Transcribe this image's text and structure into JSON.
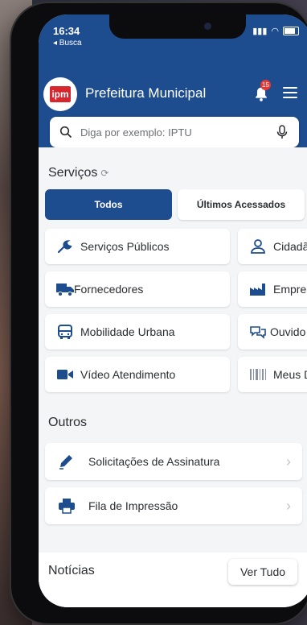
{
  "status": {
    "time": "16:34",
    "back": "◂ Busca"
  },
  "header": {
    "logo_text": "ipm",
    "title": "Prefeitura Municipal",
    "notification_count": "15"
  },
  "search": {
    "placeholder": "Diga por exemplo: IPTU"
  },
  "services": {
    "title": "Serviços",
    "tabs": [
      {
        "label": "Todos",
        "active": true
      },
      {
        "label": "Últimos Acessados",
        "active": false
      }
    ],
    "cards": [
      {
        "label": "Serviços Públicos",
        "icon": "wrench-icon"
      },
      {
        "label": "Cidadã",
        "icon": "person-icon"
      },
      {
        "label": "Fornecedores",
        "icon": "truck-icon"
      },
      {
        "label": "Empre",
        "icon": "factory-icon"
      },
      {
        "label": "Mobilidade Urbana",
        "icon": "bus-icon"
      },
      {
        "label": "Ouvido",
        "icon": "chat-icon"
      },
      {
        "label": "Vídeo Atendimento",
        "icon": "video-icon"
      },
      {
        "label": "Meus D",
        "icon": "barcode-icon"
      }
    ]
  },
  "others": {
    "title": "Outros",
    "items": [
      {
        "label": "Solicitações de Assinatura",
        "icon": "pen-icon"
      },
      {
        "label": "Fila de Impressão",
        "icon": "printer-icon"
      }
    ]
  },
  "news": {
    "title": "Notícias",
    "button": "Ver Tudo"
  },
  "colors": {
    "primary": "#1d4c8f",
    "accent": "#d7262e",
    "badge": "#e53935",
    "background": "#f4f5f7"
  }
}
